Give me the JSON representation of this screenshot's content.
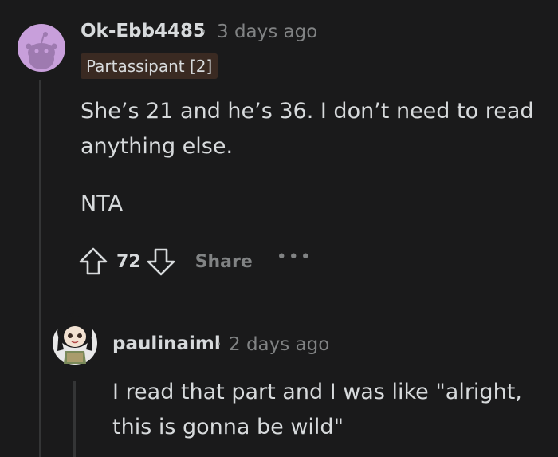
{
  "comment": {
    "username": "Ok-Ebb4485",
    "separator": "·",
    "timestamp": "3 days ago",
    "flair": "Partassipant [2]",
    "body": [
      "She’s 21 and he’s 36. I don’t need to read anything else.",
      "NTA"
    ],
    "votes": "72",
    "share_label": "Share",
    "more_label": "•••",
    "avatar_icon": "snoo-avatar-icon",
    "upvote_icon": "upvote-arrow-icon",
    "downvote_icon": "downvote-arrow-icon",
    "accent_colors": {
      "background": "#1a1a1b",
      "avatar_bg": "#c89fdb",
      "flair_bg": "#3a2a22",
      "muted_text": "#818384",
      "thread_line": "#343536"
    }
  },
  "reply": {
    "username": "paulinaiml",
    "separator": "·",
    "timestamp": "2 days ago",
    "body": "I read that part and I was like \"alright, this is gonna be wild\"",
    "avatar_icon": "custom-avatar-icon"
  }
}
